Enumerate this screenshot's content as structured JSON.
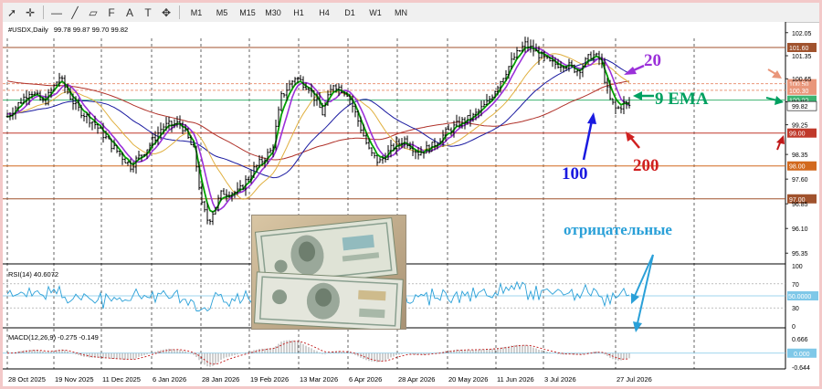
{
  "toolbar": {
    "tools": [
      {
        "icon": "cursor-icon",
        "glyph": "➚"
      },
      {
        "icon": "crosshair-icon",
        "glyph": "✛"
      },
      {
        "icon": "horizontal-line-icon",
        "glyph": "—"
      },
      {
        "icon": "trendline-icon",
        "glyph": "╱"
      },
      {
        "icon": "channel-icon",
        "glyph": "▱"
      },
      {
        "icon": "fibonacci-icon",
        "glyph": "F"
      },
      {
        "icon": "text-tool-icon",
        "glyph": "A"
      },
      {
        "icon": "label-tool-icon",
        "glyph": "T"
      },
      {
        "icon": "shapes-icon",
        "glyph": "✥"
      }
    ],
    "timeframes": [
      "M1",
      "M5",
      "M15",
      "M30",
      "H1",
      "H4",
      "D1",
      "W1",
      "MN"
    ]
  },
  "header": {
    "symbol": "#USDX,Daily",
    "ohlc": "99.78 99.87 99.70 99.82"
  },
  "price_axis": {
    "ticks": [
      "102.05",
      "101.35",
      "100.65",
      "99.95",
      "99.25",
      "98.35",
      "97.60",
      "96.85",
      "96.10",
      "95.35"
    ],
    "levels": [
      {
        "label": "101.60",
        "value": 101.6,
        "color": "#a0522d"
      },
      {
        "label": "100.50",
        "value": 100.5,
        "color": "#e9967a"
      },
      {
        "label": "100.30",
        "value": 100.3,
        "color": "#e9967a"
      },
      {
        "label": "100.00",
        "value": 100.0,
        "color": "#3cb371"
      },
      {
        "label": "99.00",
        "value": 99.0,
        "color": "#c0392b"
      },
      {
        "label": "98.00",
        "value": 98.0,
        "color": "#d2691e"
      },
      {
        "label": "97.00",
        "value": 97.0,
        "color": "#a0522d"
      }
    ],
    "current": "99.82"
  },
  "date_axis": [
    "28 Oct 2025",
    "19 Nov 2025",
    "11 Dec 2025",
    "6 Jan 2026",
    "28 Jan 2026",
    "19 Feb 2026",
    "13 Mar 2026",
    "6 Apr 2026",
    "28 Apr 2026",
    "20 May 2026",
    "11 Jun 2026",
    "3 Jul 2026",
    "27 Jul 2026"
  ],
  "annotations": {
    "ma20": "20",
    "ema9": "9 EMA",
    "ma100": "100",
    "ma200": "200",
    "negative": "отрицательные"
  },
  "rsi": {
    "label": "RSI(14) 40.6072",
    "ticks": [
      "100",
      "70",
      "50",
      "30",
      "0"
    ],
    "level_label": "50.0000",
    "current": 40.6
  },
  "macd": {
    "label": "MACD(12,26,9) -0.275 -0.149",
    "ticks": [
      "0.666",
      "0.000",
      "-0.644"
    ],
    "main": -0.275,
    "signal": -0.149
  },
  "colors": {
    "ema9": "#00a000",
    "ma20": "#9b30d9",
    "ma50": "#e0b040",
    "ma100": "#1a1aa0",
    "ma200": "#b0322a",
    "rsi": "#2aa0d8",
    "annotation_blue": "#2aa0d8"
  }
}
